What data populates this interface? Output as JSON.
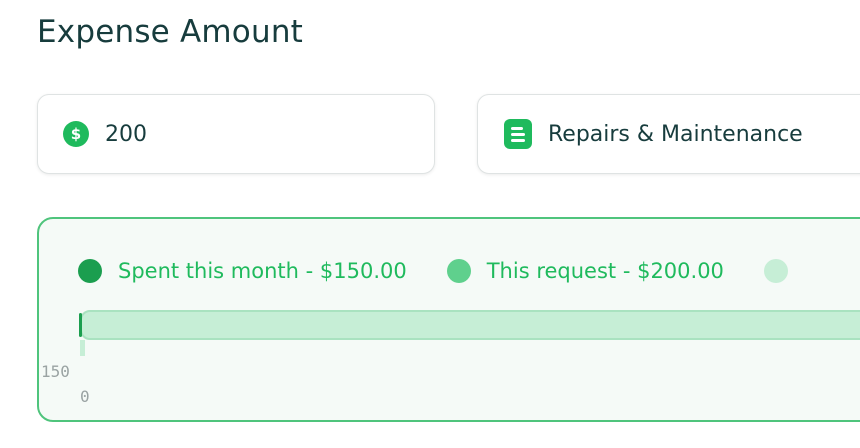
{
  "header": {
    "title": "Expense Amount"
  },
  "amount_field": {
    "value": "200",
    "icon": "dollar-circle-icon"
  },
  "category_field": {
    "value": "Repairs & Maintenance",
    "icon": "document-icon"
  },
  "budget": {
    "legend": [
      {
        "label": "Spent this month - $150.00",
        "color": "#1b9e4f"
      },
      {
        "label": "This request - $200.00",
        "color": "#5fd08d"
      },
      {
        "label": "",
        "color": "#c6eed6"
      }
    ],
    "tick_upper": "150",
    "tick_lower": "0"
  }
}
